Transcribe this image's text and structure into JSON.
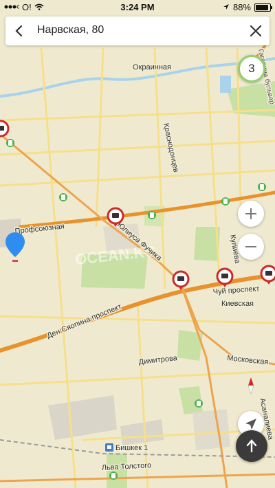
{
  "status_bar": {
    "carrier": "О!",
    "time": "3:24 PM",
    "battery": "88%",
    "battery_level": 0.88
  },
  "search": {
    "query": "Нарвская, 80"
  },
  "traffic_level": "3",
  "watermark": "OCEAN.KG",
  "map_labels": {
    "okrainnaya": "Окраинная",
    "krasnodontsev": "Краснодонцев",
    "profsoyuznaya": "Профсоюзная",
    "yuliusa_fuchika": "Юлиуса Фучика",
    "kulieva": "Кулиева",
    "chuy_prospekt": "Чуй проспект",
    "kievskaya": "Киевская",
    "den_syaopina": "Ден Сяопина проспект",
    "dimitrova": "Димитрова",
    "moskovskaya": "Московская",
    "asanalieva": "Асаналиева",
    "bishkek1": "Бишкек 1",
    "lva_tolstogo": "Льва Толстого",
    "gagarin_blvd": "Гагарина бульвар"
  },
  "icons": {
    "back": "chevron-left-icon",
    "close": "close-icon",
    "zoom_in": "plus-icon",
    "zoom_out": "minus-icon",
    "locate": "navigation-arrow-icon",
    "route": "arrow-up-icon",
    "camera": "speed-camera-icon",
    "pin": "location-pin-icon",
    "gas": "gas-station-icon",
    "compass": "compass-icon"
  },
  "colors": {
    "road_major": "#e8922e",
    "road_minor": "#f6df8c",
    "park": "#c8e0a4",
    "water": "#a9d3ea",
    "pin": "#2f8cf0",
    "camera": "#cc2a2a"
  }
}
